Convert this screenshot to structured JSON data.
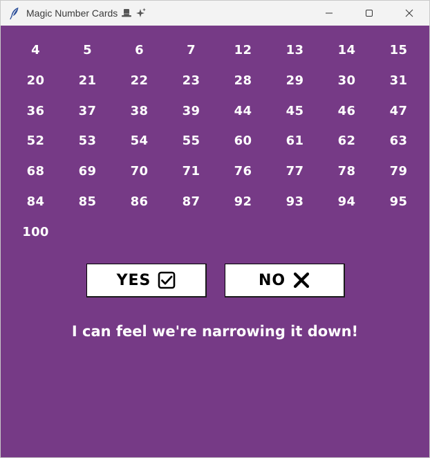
{
  "window": {
    "title": "Magic Number Cards"
  },
  "card": {
    "numbers": [
      "4",
      "5",
      "6",
      "7",
      "12",
      "13",
      "14",
      "15",
      "20",
      "21",
      "22",
      "23",
      "28",
      "29",
      "30",
      "31",
      "36",
      "37",
      "38",
      "39",
      "44",
      "45",
      "46",
      "47",
      "52",
      "53",
      "54",
      "55",
      "60",
      "61",
      "62",
      "63",
      "68",
      "69",
      "70",
      "71",
      "76",
      "77",
      "78",
      "79",
      "84",
      "85",
      "86",
      "87",
      "92",
      "93",
      "94",
      "95",
      "100"
    ]
  },
  "buttons": {
    "yes_label": "YES",
    "no_label": "NO"
  },
  "message": "I can feel we're narrowing it down!",
  "icons": {
    "app": "feather-icon",
    "title_emojis": [
      "top-hat-icon",
      "sparkles-icon"
    ],
    "yes": "checkbox-checked-icon",
    "no": "x-mark-icon"
  },
  "colors": {
    "background": "#763a86",
    "titlebar": "#f3f3f3",
    "text": "#ffffff",
    "button_bg": "#ffffff",
    "button_text": "#000000"
  }
}
